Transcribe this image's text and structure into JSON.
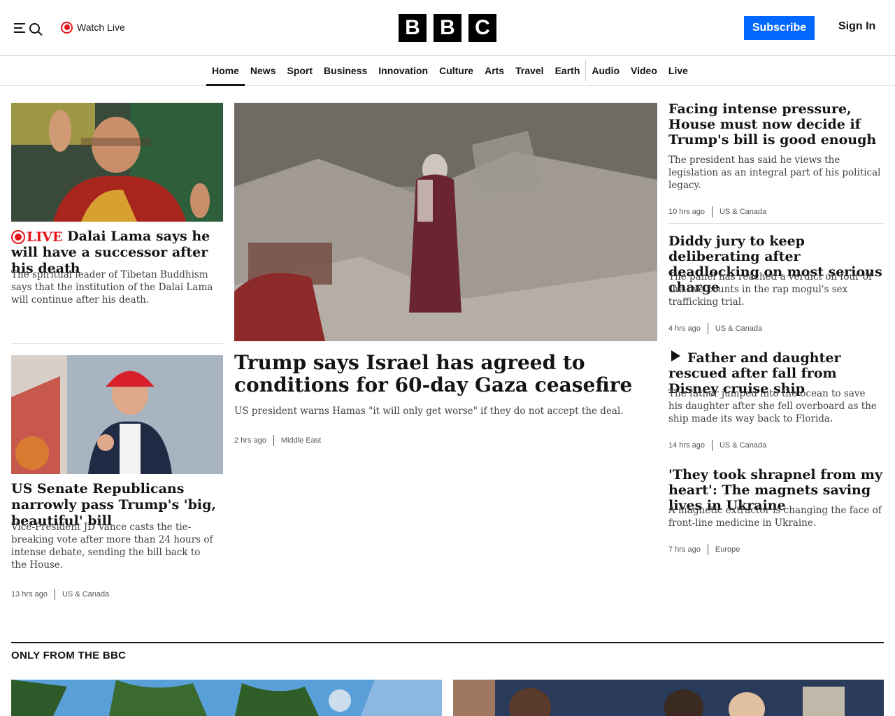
{
  "header": {
    "watch_live": "Watch Live",
    "logo_letters": [
      "B",
      "B",
      "C"
    ],
    "subscribe": "Subscribe",
    "sign_in": "Sign In",
    "accent_color": "#0068ff",
    "live_color": "#e5171c"
  },
  "nav": {
    "items": [
      "Home",
      "News",
      "Sport",
      "Business",
      "Innovation",
      "Culture",
      "Arts",
      "Travel",
      "Earth",
      "Audio",
      "Video",
      "Live"
    ],
    "active": "Home"
  },
  "left": {
    "story1": {
      "live_label": "LIVE",
      "headline": "Dalai Lama says he will have a successor after his death",
      "summary": "The spiritual leader of Tibetan Buddhism says that the institution of the Dalai Lama will continue after his death."
    },
    "story2": {
      "headline": "US Senate Republicans narrowly pass Trump's 'big, beautiful' bill",
      "summary": "Vice-President JD Vance casts the tie-breaking vote after more than 24 hours of intense debate, sending the bill back to the House.",
      "time": "13 hrs ago",
      "section": "US & Canada"
    }
  },
  "lead": {
    "headline": "Trump says Israel has agreed to conditions for 60-day Gaza ceasefire",
    "summary": "US president warns Hamas \"it will only get worse\" if they do not accept the deal.",
    "time": "2 hrs ago",
    "section": "Middle East"
  },
  "right": [
    {
      "headline": "Facing intense pressure, House must now decide if Trump's bill is good enough",
      "summary": "The president has said he views the legislation as an integral part of his political legacy.",
      "time": "10 hrs ago",
      "section": "US & Canada"
    },
    {
      "headline": "Diddy jury to keep deliberating after deadlocking on most serious charge",
      "summary": "The panel has reached a verdict on four of the five counts in the rap mogul's sex trafficking trial.",
      "time": "4 hrs ago",
      "section": "US & Canada"
    },
    {
      "headline": "Father and daughter rescued after fall from Disney cruise ship",
      "summary": "The father jumped into the ocean to save his daughter after she fell overboard as the ship made its way back to Florida.",
      "time": "14 hrs ago",
      "section": "US & Canada"
    },
    {
      "headline": "'They took shrapnel from my heart': The magnets saving lives in Ukraine",
      "summary": "A magnetic extractor is changing the face of front-line medicine in Ukraine.",
      "time": "7 hrs ago",
      "section": "Europe"
    }
  ],
  "only_from_bbc": {
    "title": "ONLY FROM THE BBC"
  }
}
